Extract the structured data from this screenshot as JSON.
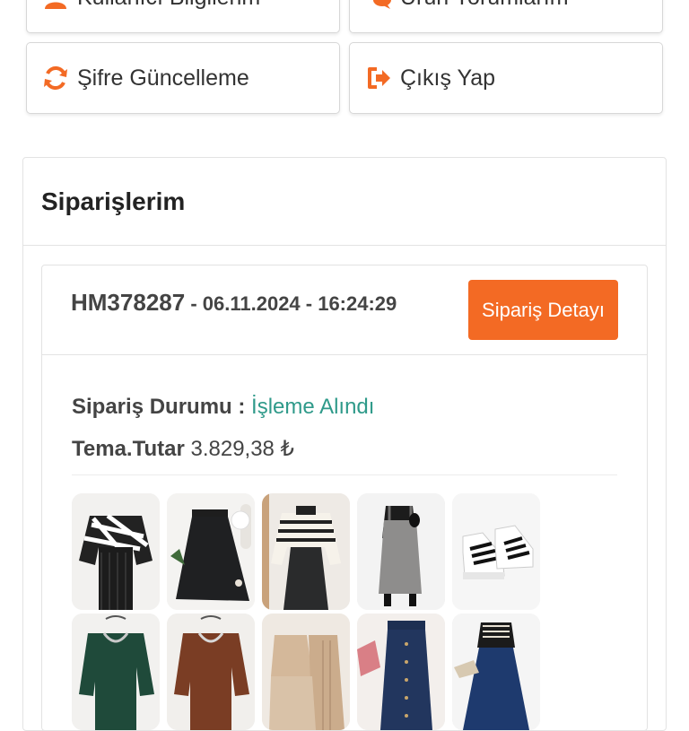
{
  "menu": {
    "user_info": "Kullanıcı Bilgilerim",
    "reviews": "Ürün Yorumlarım",
    "password": "Şifre Güncelleme",
    "logout": "Çıkış Yap"
  },
  "orders": {
    "title": "Siparişlerim",
    "order": {
      "code": "HM378287",
      "separator": " - ",
      "datetime": "06.11.2024 - 16:24:29",
      "detail_button": "Sipariş Detayı",
      "status_label": "Sipariş Durumu : ",
      "status_value": "İşleme Alındı",
      "amount_label": "Tema.Tutar",
      "amount_value": "3.829,38 ₺"
    }
  },
  "colors": {
    "accent": "#f36a24",
    "status": "#2f9a8a"
  },
  "icons": [
    "user-icon",
    "comments-icon",
    "refresh-icon",
    "sign-out-icon"
  ],
  "products": [
    "zebra-knit-sweater-outfit",
    "black-pleated-skirt-outfit",
    "striped-sweater-black-skirt-outfit",
    "grey-pinafore-dress",
    "white-black-sneakers",
    "green-sweater",
    "brown-sweater",
    "beige-two-piece-set",
    "denim-button-skirt",
    "navy-skirt-vest-outfit"
  ]
}
